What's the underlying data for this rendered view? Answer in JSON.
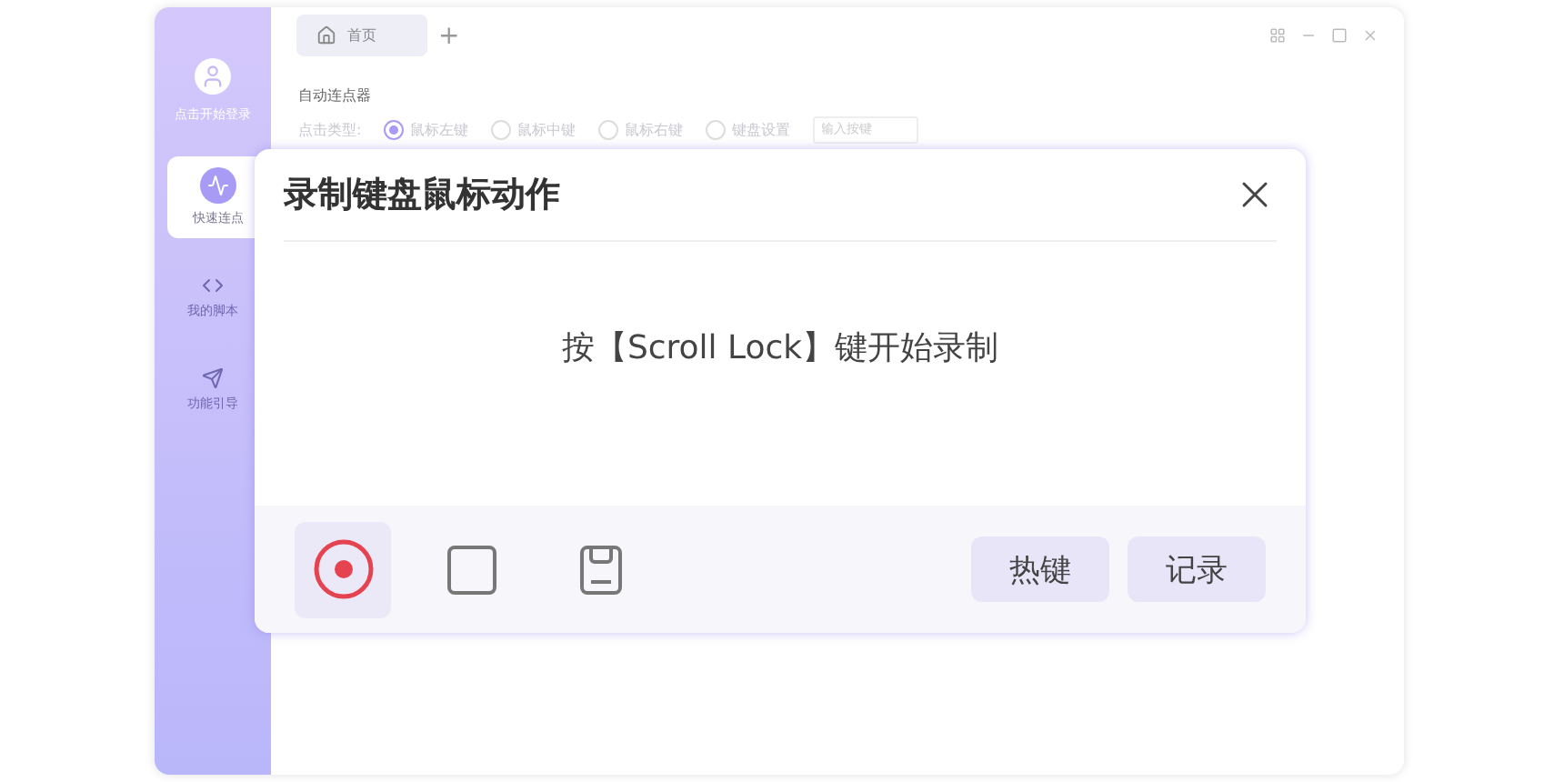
{
  "sidebar": {
    "user_label": "点击开始登录",
    "items": [
      {
        "kind": "wave",
        "label": "快速连点",
        "selected": true
      },
      {
        "kind": "code",
        "label": "我的脚本",
        "selected": false
      },
      {
        "kind": "guide",
        "label": "功能引导",
        "selected": false
      }
    ]
  },
  "tabs": [
    {
      "label": "首页",
      "selected": true
    }
  ],
  "add_tab": "+",
  "section_title": "自动连点器",
  "click_type": {
    "label": "点击类型:",
    "options": [
      {
        "label": "鼠标左键",
        "selected": true
      },
      {
        "label": "鼠标中键",
        "selected": false
      },
      {
        "label": "鼠标右键",
        "selected": false
      },
      {
        "label": "键盘设置",
        "selected": false
      }
    ],
    "key_placeholder": "输入按键"
  },
  "dialog": {
    "title": "录制键盘鼠标动作",
    "message": "按【Scroll Lock】键开始录制",
    "tools": [
      {
        "kind": "record",
        "selected": true
      },
      {
        "kind": "stop",
        "selected": false
      },
      {
        "kind": "save",
        "selected": false
      }
    ],
    "buttons": [
      "热键",
      "记录"
    ]
  }
}
